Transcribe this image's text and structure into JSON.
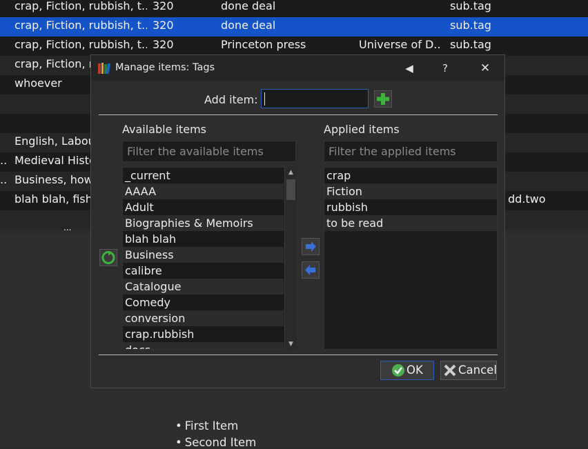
{
  "background_table": {
    "rows": [
      {
        "tags": "crap, Fiction, rubbish, t...",
        "size": "320",
        "status": "done deal",
        "publisher": "",
        "extra": "sub.tag",
        "style": "dark"
      },
      {
        "tags": "crap, Fiction, rubbish, t...",
        "size": "320",
        "status": "done deal",
        "publisher": "",
        "extra": "sub.tag",
        "style": "sel"
      },
      {
        "tags": "crap, Fiction, rubbish, t...",
        "size": "320",
        "status": "Princeton press",
        "publisher": "Universe of D...",
        "extra": "sub.tag",
        "style": "dark"
      },
      {
        "tags": "crap, Fiction, ru",
        "size": "",
        "status": "",
        "publisher": "",
        "extra": "",
        "style": "alt"
      },
      {
        "tags": "whoever",
        "size": "",
        "status": "",
        "publisher": "",
        "extra": "",
        "style": "dark"
      },
      {
        "tags": "",
        "size": "",
        "status": "",
        "publisher": "",
        "extra": "",
        "style": "alt"
      },
      {
        "tags": "",
        "size": "",
        "status": "",
        "publisher": "",
        "extra": "",
        "style": "dark"
      },
      {
        "tags": "English, Labou",
        "size": "",
        "status": "",
        "publisher": "",
        "extra": "",
        "style": "alt"
      },
      {
        "tags": "Medieval Histo",
        "size": "",
        "status": "",
        "publisher": "",
        "extra": "",
        "style": "dark",
        "prefix": ".."
      },
      {
        "tags": "Business, how",
        "size": "",
        "status": "",
        "publisher": "",
        "extra": "",
        "style": "alt",
        "prefix": ".."
      },
      {
        "tags": "blah blah, fishi",
        "size": "",
        "status": "",
        "publisher": "",
        "extra": "dd.two",
        "style": "dark"
      },
      {
        "tags": "",
        "size": "",
        "status": "",
        "publisher": "",
        "extra": "",
        "style": "alt"
      }
    ],
    "ellipsis": "..."
  },
  "bullets": [
    "First Item",
    "Second Item"
  ],
  "dialog": {
    "title": "Manage items: Tags",
    "add_item_label": "Add item:",
    "add_item_value": "",
    "available_label": "Available items",
    "applied_label": "Applied items",
    "available_filter_placeholder": "Filter the available items",
    "applied_filter_placeholder": "Filter the applied items",
    "available_items": [
      "_current",
      "AAAA",
      "Adult",
      "Biographies & Memoirs",
      "blah blah",
      "Business",
      "calibre",
      "Catalogue",
      "Comedy",
      "conversion",
      "crap.rubbish",
      "docs"
    ],
    "applied_items": [
      "crap",
      "Fiction",
      "rubbish",
      "to be read"
    ],
    "ok_label": "OK",
    "cancel_label": "Cancel",
    "help_glyph": "?",
    "close_glyph": "✕",
    "back_glyph": "◀"
  },
  "colors": {
    "accent": "#1554c8",
    "focus_border": "#2f5cb8",
    "add_green": "#3cb43c",
    "arrow_blue": "#3a6fd8"
  }
}
